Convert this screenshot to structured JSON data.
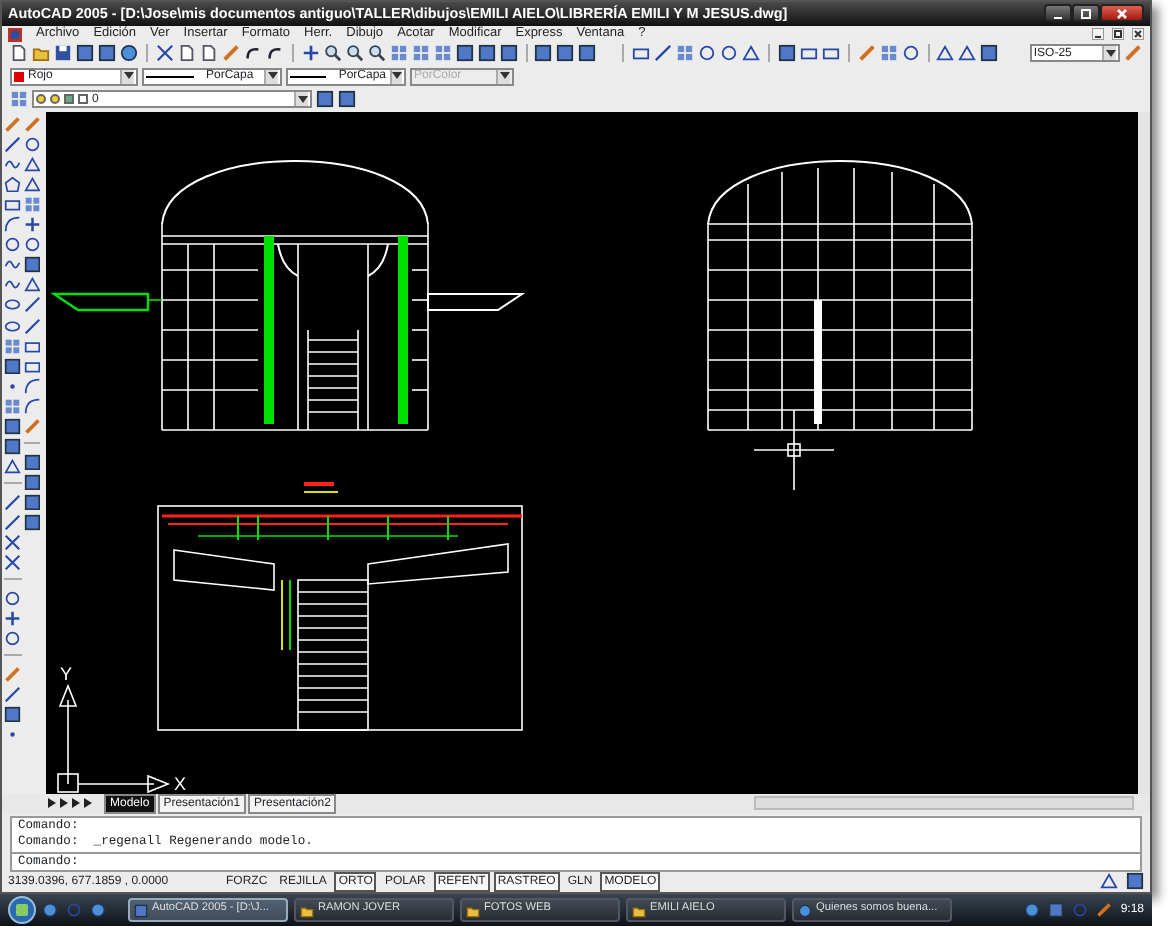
{
  "window": {
    "title": "AutoCAD 2005 - [D:\\Jose\\mis documentos antiguo\\TALLER\\dibujos\\EMILI AIELO\\LIBRERÍA EMILI Y M JESUS.dwg]"
  },
  "menu": [
    "Archivo",
    "Edición",
    "Ver",
    "Insertar",
    "Formato",
    "Herr.",
    "Dibujo",
    "Acotar",
    "Modificar",
    "Express",
    "Ventana",
    "?"
  ],
  "properties": {
    "color": {
      "value": "Rojo",
      "color": "#e00000"
    },
    "linetype": {
      "value": "PorCapa"
    },
    "lineweight": {
      "value": "PorCapa"
    },
    "plotstyle": {
      "value": "PorColor",
      "disabled": true
    }
  },
  "layer": {
    "value": "0"
  },
  "dimstyle": {
    "value": "ISO-25"
  },
  "ucs_icon": {
    "y_label": "Y",
    "x_label": "X"
  },
  "layout_tabs": [
    {
      "label": "Modelo",
      "selected": true
    },
    {
      "label": "Presentación1",
      "selected": false
    },
    {
      "label": "Presentación2",
      "selected": false
    }
  ],
  "command_history": [
    "Comando:",
    "Comando:  _regenall Regenerando modelo."
  ],
  "command_prompt": "Comando:",
  "status_bar": {
    "coordinates": "3139.0396, 677.1859 , 0.0000",
    "toggles": [
      {
        "label": "FORZC",
        "on": false
      },
      {
        "label": "REJILLA",
        "on": false
      },
      {
        "label": "ORTO",
        "on": true
      },
      {
        "label": "POLAR",
        "on": false
      },
      {
        "label": "REFENT",
        "on": true
      },
      {
        "label": "RASTREO",
        "on": true
      },
      {
        "label": "GLN",
        "on": false
      },
      {
        "label": "MODELO",
        "on": true
      }
    ]
  },
  "taskbar": {
    "items": [
      {
        "label": "AutoCAD 2005 - [D:\\J...",
        "selected": true
      },
      {
        "label": "RAMON JOVER",
        "selected": false
      },
      {
        "label": "FOTOS WEB",
        "selected": false
      },
      {
        "label": "EMILI AIELO",
        "selected": false
      },
      {
        "label": "Quienes somos buena...",
        "selected": false
      }
    ],
    "clock": "9:18"
  }
}
